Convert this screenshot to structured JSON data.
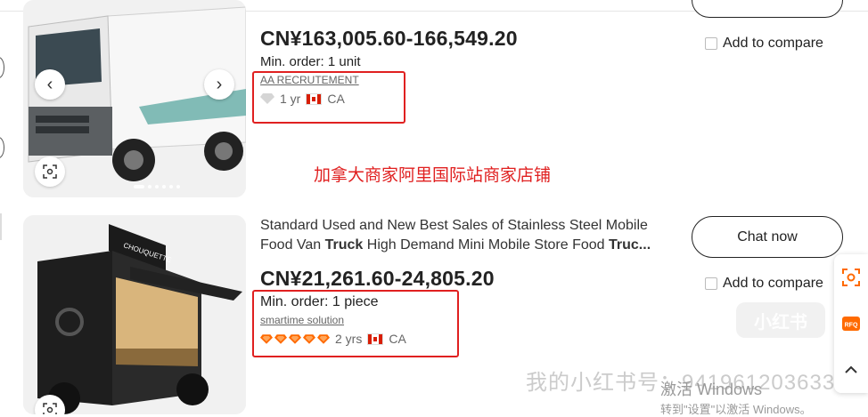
{
  "products": [
    {
      "price": "CN¥163,005.60-166,549.20",
      "min_order": "Min. order: 1 unit",
      "supplier": "AA RECRUTEMENT",
      "years": "1 yr",
      "country": "CA",
      "compare_label": "Add to compare"
    },
    {
      "title_line1": "Standard Used and New Best Sales of Stainless Steel Mobile",
      "title_line2_a": "Food Van ",
      "title_line2_b": "Truck",
      "title_line2_c": " High Demand Mini Mobile Store Food ",
      "title_line2_d": "Truc...",
      "price": "CN¥21,261.60-24,805.20",
      "min_order": "Min. order: 1 piece",
      "supplier": "smartime solution",
      "years": "2 yrs",
      "country": "CA",
      "chat_label": "Chat now",
      "compare_label": "Add to compare",
      "van_brand": "CHOUQUETTE"
    }
  ],
  "annotation": "加拿大商家阿里国际站商家店铺",
  "side_panel": {
    "rfq_label": "RFQ"
  },
  "watermarks": {
    "xhs_id": "我的小红书号：941961203633",
    "xhs_logo": "小红书",
    "windows_line1": "激活 Windows",
    "windows_line2": "转到\"设置\"以激活 Windows。"
  },
  "colors": {
    "annotation_red": "#e02020",
    "accent_orange": "#ff6a00"
  }
}
